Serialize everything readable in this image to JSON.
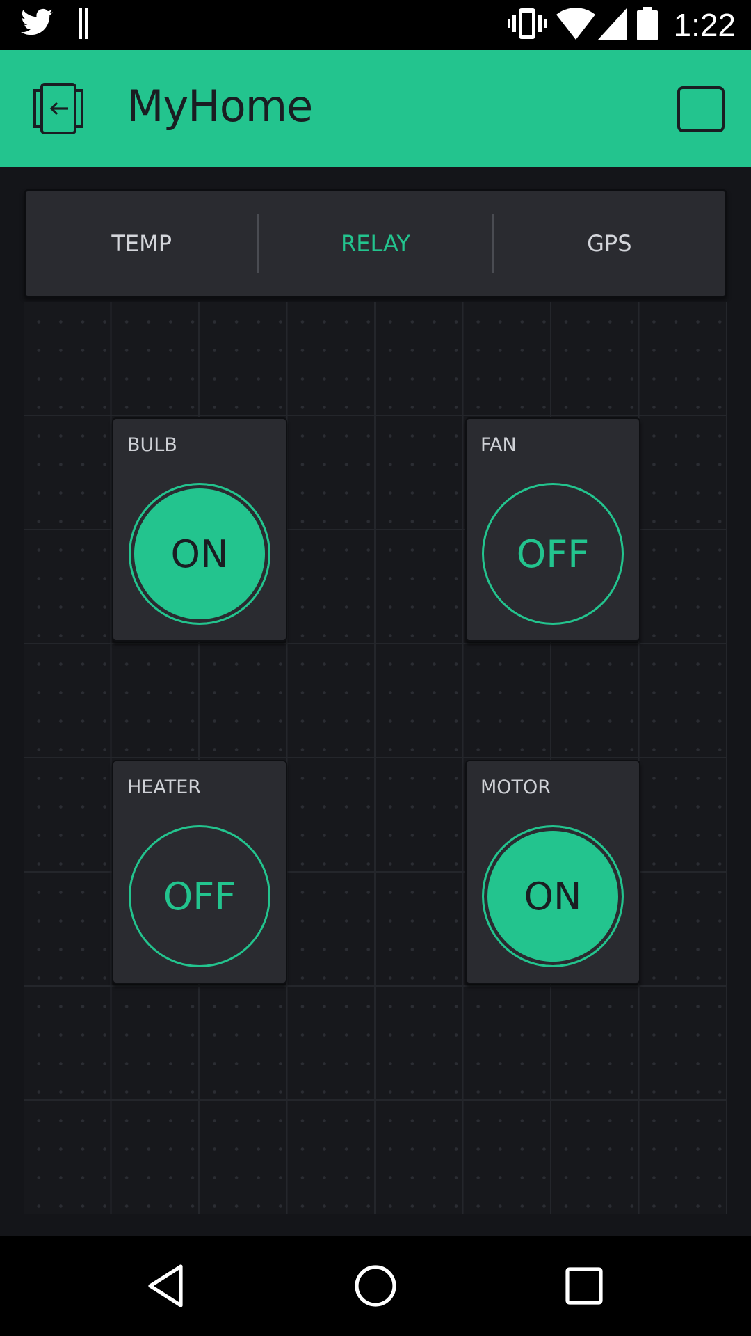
{
  "status_bar": {
    "time": "1:22",
    "icons": [
      "twitter-icon",
      "pause-icon",
      "vibrate-icon",
      "wifi-icon",
      "cell-signal-icon",
      "battery-icon"
    ]
  },
  "app_bar": {
    "title": "MyHome",
    "background_color": "#23c48e"
  },
  "tabs": [
    {
      "label": "TEMP",
      "active": false
    },
    {
      "label": "RELAY",
      "active": true
    },
    {
      "label": "GPS",
      "active": false
    }
  ],
  "widgets": [
    {
      "label": "BULB",
      "state": "ON"
    },
    {
      "label": "FAN",
      "state": "OFF"
    },
    {
      "label": "HEATER",
      "state": "OFF"
    },
    {
      "label": "MOTOR",
      "state": "ON"
    }
  ],
  "nav_bar": {
    "icons": [
      "back-icon",
      "home-icon",
      "recents-icon"
    ]
  },
  "colors": {
    "accent": "#23c48e",
    "background": "#141519",
    "widget": "#2a2b30"
  }
}
